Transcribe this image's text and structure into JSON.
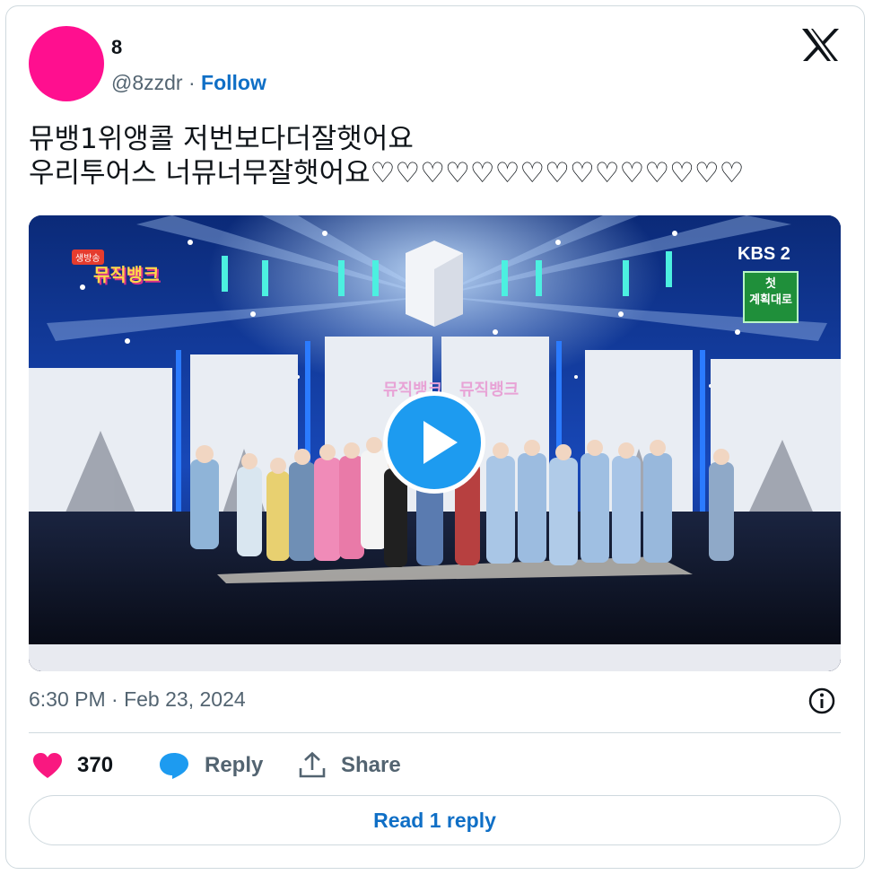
{
  "author": {
    "display_name": "8",
    "handle": "@8zzdr",
    "separator": " · ",
    "follow_label": "Follow",
    "avatar_color": "#ff0f8f"
  },
  "header": {
    "logo_icon": "x-logo-icon"
  },
  "tweet": {
    "lines": [
      "뮤뱅1위앵콜 저번보다더잘햇어요",
      "우리투어스 너뮤너무잘햇어요♡♡♡♡♡♡♡♡♡♡♡♡♡♡♡"
    ]
  },
  "media": {
    "type": "video",
    "play_icon": "play-icon",
    "overlay": {
      "show_logo": "뮤직뱅크",
      "live_badge": "생방송",
      "broadcaster": "KBS 2",
      "caption_top": "첫",
      "caption_bottom": "계획대로",
      "stage_logo": "뮤직뱅크"
    }
  },
  "meta": {
    "timestamp": "6:30 PM · Feb 23, 2024"
  },
  "actions": {
    "like_count": "370",
    "reply_label": "Reply",
    "share_label": "Share"
  },
  "footer": {
    "read_replies_label": "Read 1 reply"
  },
  "colors": {
    "like": "#f91880",
    "reply": "#1d9bf0",
    "link": "#0f6fc6",
    "text": "#0f1419",
    "muted": "#536471",
    "border": "#cfd9de"
  }
}
